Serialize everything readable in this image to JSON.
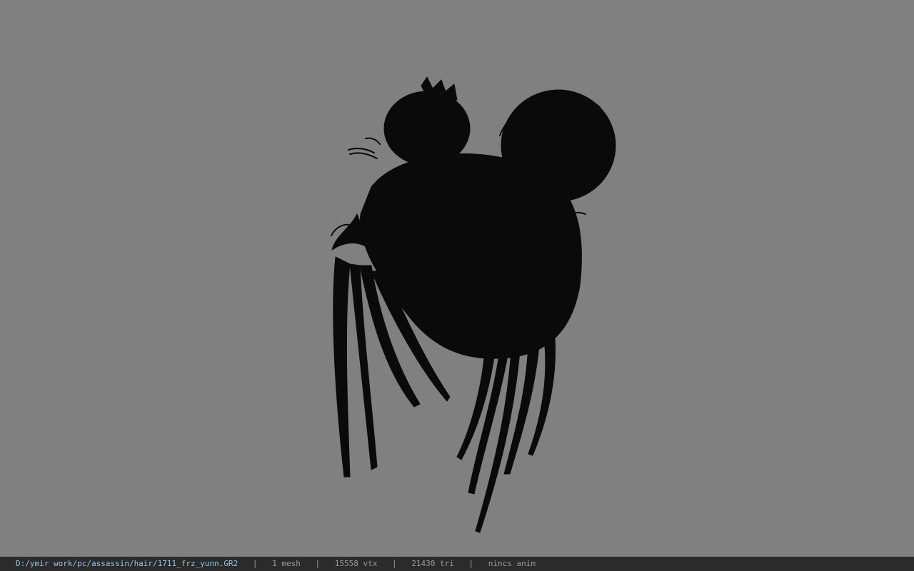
{
  "viewport": {
    "background_color": "#808080",
    "model_color": "#0a0a0a",
    "model_name": "hair mesh silhouette"
  },
  "statusbar": {
    "file_path": "D:/ymir work/pc/assassin/hair/1711_frz_yunn.GR2",
    "separator": "|",
    "mesh_count": "1 mesh",
    "vertex_count": "15558 vtx",
    "triangle_count": "21430 tri",
    "anim_status": "nincs anim",
    "path_color": "#8ec6e6",
    "text_color": "#9a9a9a",
    "background_color": "#2b2b2b"
  }
}
